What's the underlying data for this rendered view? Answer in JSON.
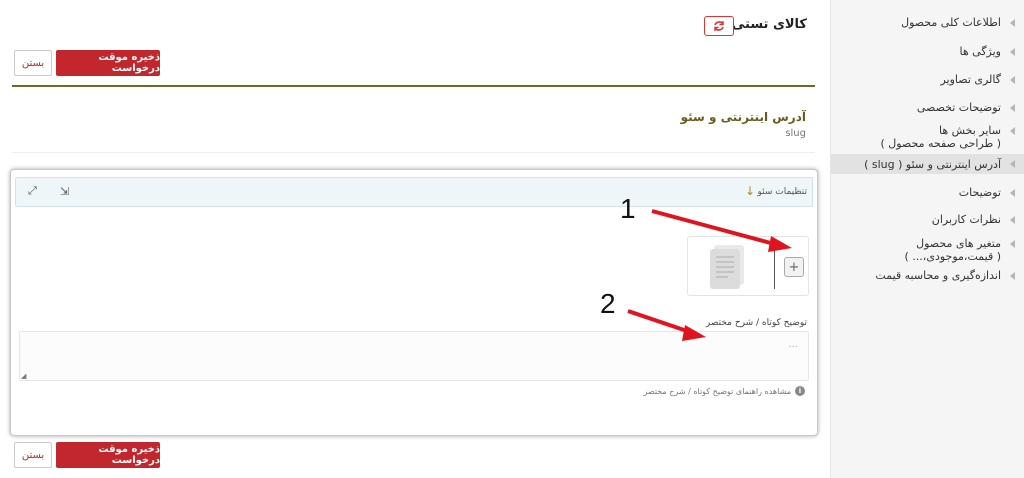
{
  "header": {
    "product_title": "کالای تستی",
    "save_label": "ذخیره موقت درخواست",
    "close_label": "بستن"
  },
  "section": {
    "title": "آدرس اینترنتی و سئو",
    "subtitle": "slug"
  },
  "seo": {
    "bar_label": "تنظیمات سئو",
    "description_label": "توضیح کوتاه / شرح مختصر",
    "description_placeholder": "...",
    "help_text": "مشاهده راهنمای توضیح کوتاه / شرح مختصر"
  },
  "annotations": [
    "1",
    "2"
  ],
  "sidebar": {
    "items": [
      {
        "label": "اطلاعات کلی محصول"
      },
      {
        "label": "ویژگی ها"
      },
      {
        "label": "گالری تصاویر"
      },
      {
        "label": "توضیحات تخصصی"
      },
      {
        "label": "سایر بخش ها",
        "label2": "( طراحی صفحه محصول )"
      },
      {
        "label": "آدرس اینترنتی و سئو ( slug )"
      },
      {
        "label": "توضیحات"
      },
      {
        "label": "نظرات کاربران"
      },
      {
        "label": "متغیر های محصول",
        "label2": "( قیمت،موجودی،... )"
      },
      {
        "label": "اندازه‌گیری و محاسبه قیمت"
      }
    ]
  },
  "colors": {
    "primary": "#c1272d",
    "divider": "#6b6b2a",
    "sidebar_bg": "#f5f5f5",
    "annotation_arrow": "#e0141e"
  }
}
